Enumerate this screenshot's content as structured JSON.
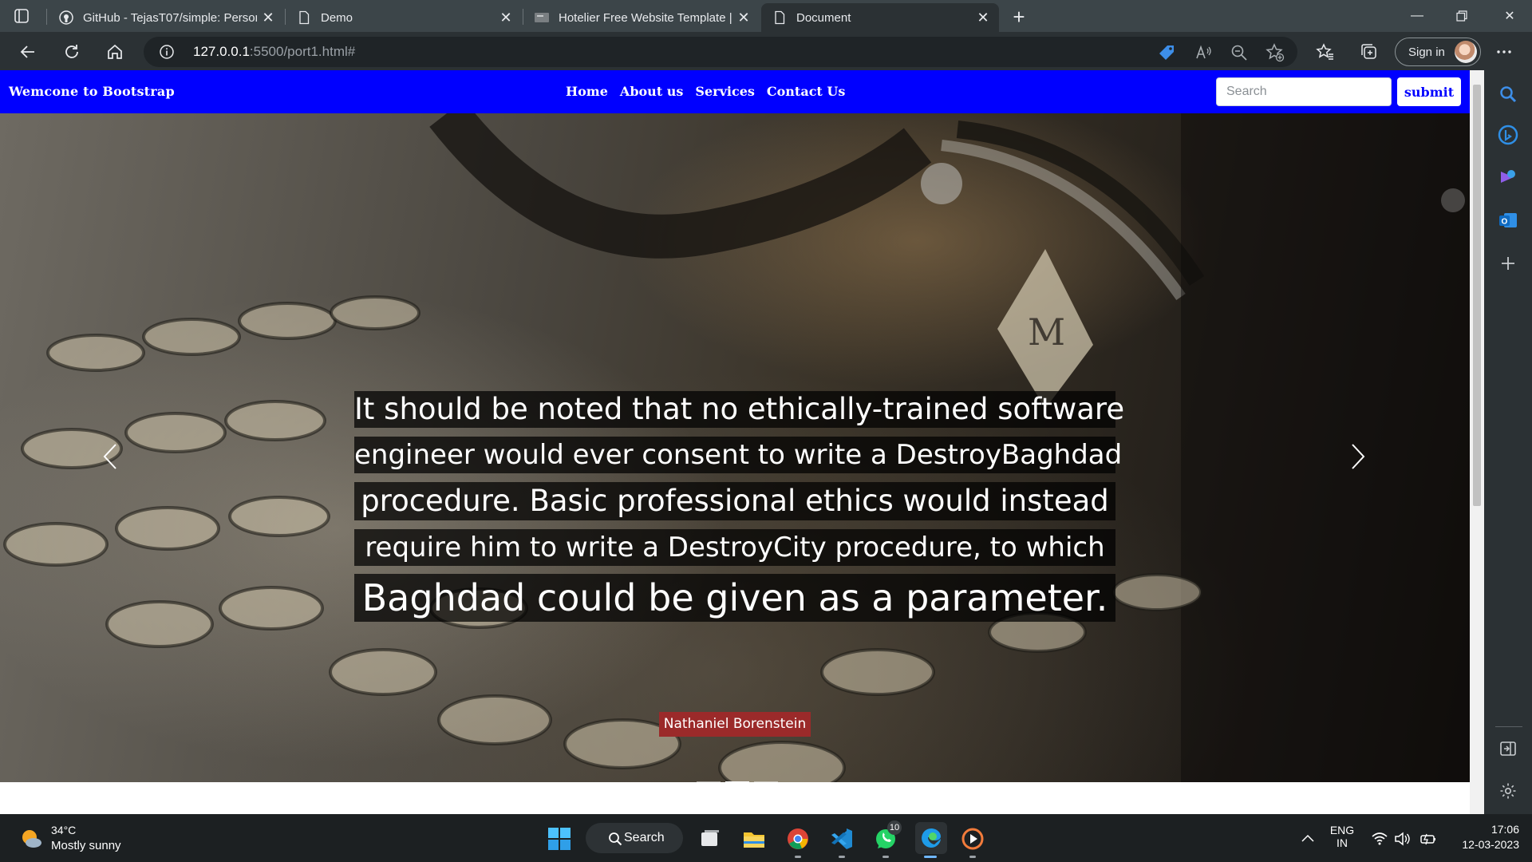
{
  "browser": {
    "tabs": [
      {
        "title": "GitHub - TejasT07/simple: Person",
        "icon": "github-icon",
        "active": false
      },
      {
        "title": "Demo",
        "icon": "page-icon",
        "active": false
      },
      {
        "title": "Hotelier Free Website Template |",
        "icon": "site-thumbnail-icon",
        "active": false
      },
      {
        "title": "Document",
        "icon": "page-icon",
        "active": true
      }
    ],
    "url_host": "127.0.0.1",
    "url_rest": ":5500/port1.html#",
    "sign_in_label": "Sign in"
  },
  "page": {
    "brand": "Wemcone to Bootstrap",
    "nav": [
      "Home",
      "About us",
      "Services",
      "Contact Us"
    ],
    "search_placeholder": "Search",
    "submit_label": "submit",
    "quote_lines": [
      "It should be noted that no ethically-trained software",
      "engineer would ever consent to write a DestroyBaghdad",
      "procedure. Basic professional ethics would instead",
      "require him to write a DestroyCity procedure, to which",
      "Baghdad could be given as a parameter."
    ],
    "author": "Nathaniel Borenstein",
    "active_slide_index": 1,
    "slide_count": 3,
    "colors": {
      "navbar": "#0000ff",
      "author_badge": "#9b2a2a"
    }
  },
  "taskbar": {
    "weather_temp": "34°C",
    "weather_condition": "Mostly sunny",
    "search_label": "Search",
    "whatsapp_badge": "10",
    "lang_top": "ENG",
    "lang_bottom": "IN",
    "time": "17:06",
    "date": "12-03-2023"
  }
}
